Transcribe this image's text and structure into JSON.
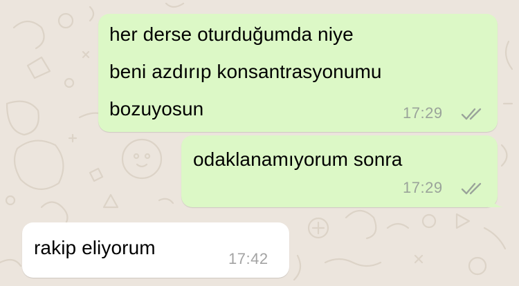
{
  "messages": [
    {
      "direction": "outgoing",
      "lines": [
        "her derse oturduğumda niye",
        "beni azdırıp konsantrasyonumu",
        "bozuyosun"
      ],
      "time": "17:29",
      "status": "read-double-check"
    },
    {
      "direction": "outgoing",
      "lines": [
        "odaklanamıyorum sonra"
      ],
      "time": "17:29",
      "status": "read-double-check"
    },
    {
      "direction": "incoming",
      "lines": [
        "rakip eliyorum"
      ],
      "time": "17:42"
    }
  ],
  "colors": {
    "outgoing_bubble": "#DCF8C6",
    "incoming_bubble": "#FFFFFF",
    "wallpaper": "#ECE5DD",
    "timestamp": "#9AA39A"
  },
  "icons": {
    "status": "double-check-icon",
    "wallpaper": "doodle-pattern"
  }
}
